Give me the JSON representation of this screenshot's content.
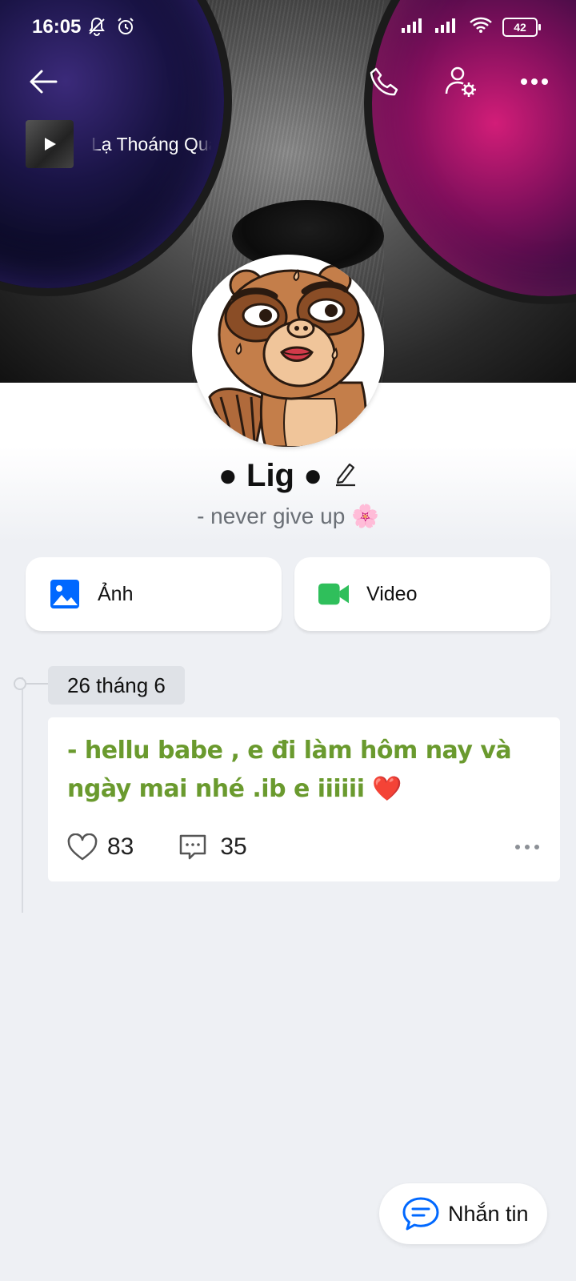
{
  "status_bar": {
    "time": "16:05",
    "battery": "42"
  },
  "music": {
    "title": "Lạ Thoáng Qua"
  },
  "profile": {
    "name": "● Lig ●",
    "status": "- never give up 🌸"
  },
  "media": {
    "photos_label": "Ảnh",
    "videos_label": "Video"
  },
  "timeline": {
    "date": "26 tháng 6",
    "post": {
      "text": "- hellu babe , e đi làm hôm nay và ngày mai nhé .ib e iiiiii ❤️",
      "likes": "83",
      "comments": "35"
    }
  },
  "fab": {
    "message_label": "Nhắn tin"
  },
  "colors": {
    "accent_blue": "#0068ff",
    "video_green": "#2fbf5b",
    "post_text_green": "#6a9a2e",
    "background": "#eef0f4"
  }
}
